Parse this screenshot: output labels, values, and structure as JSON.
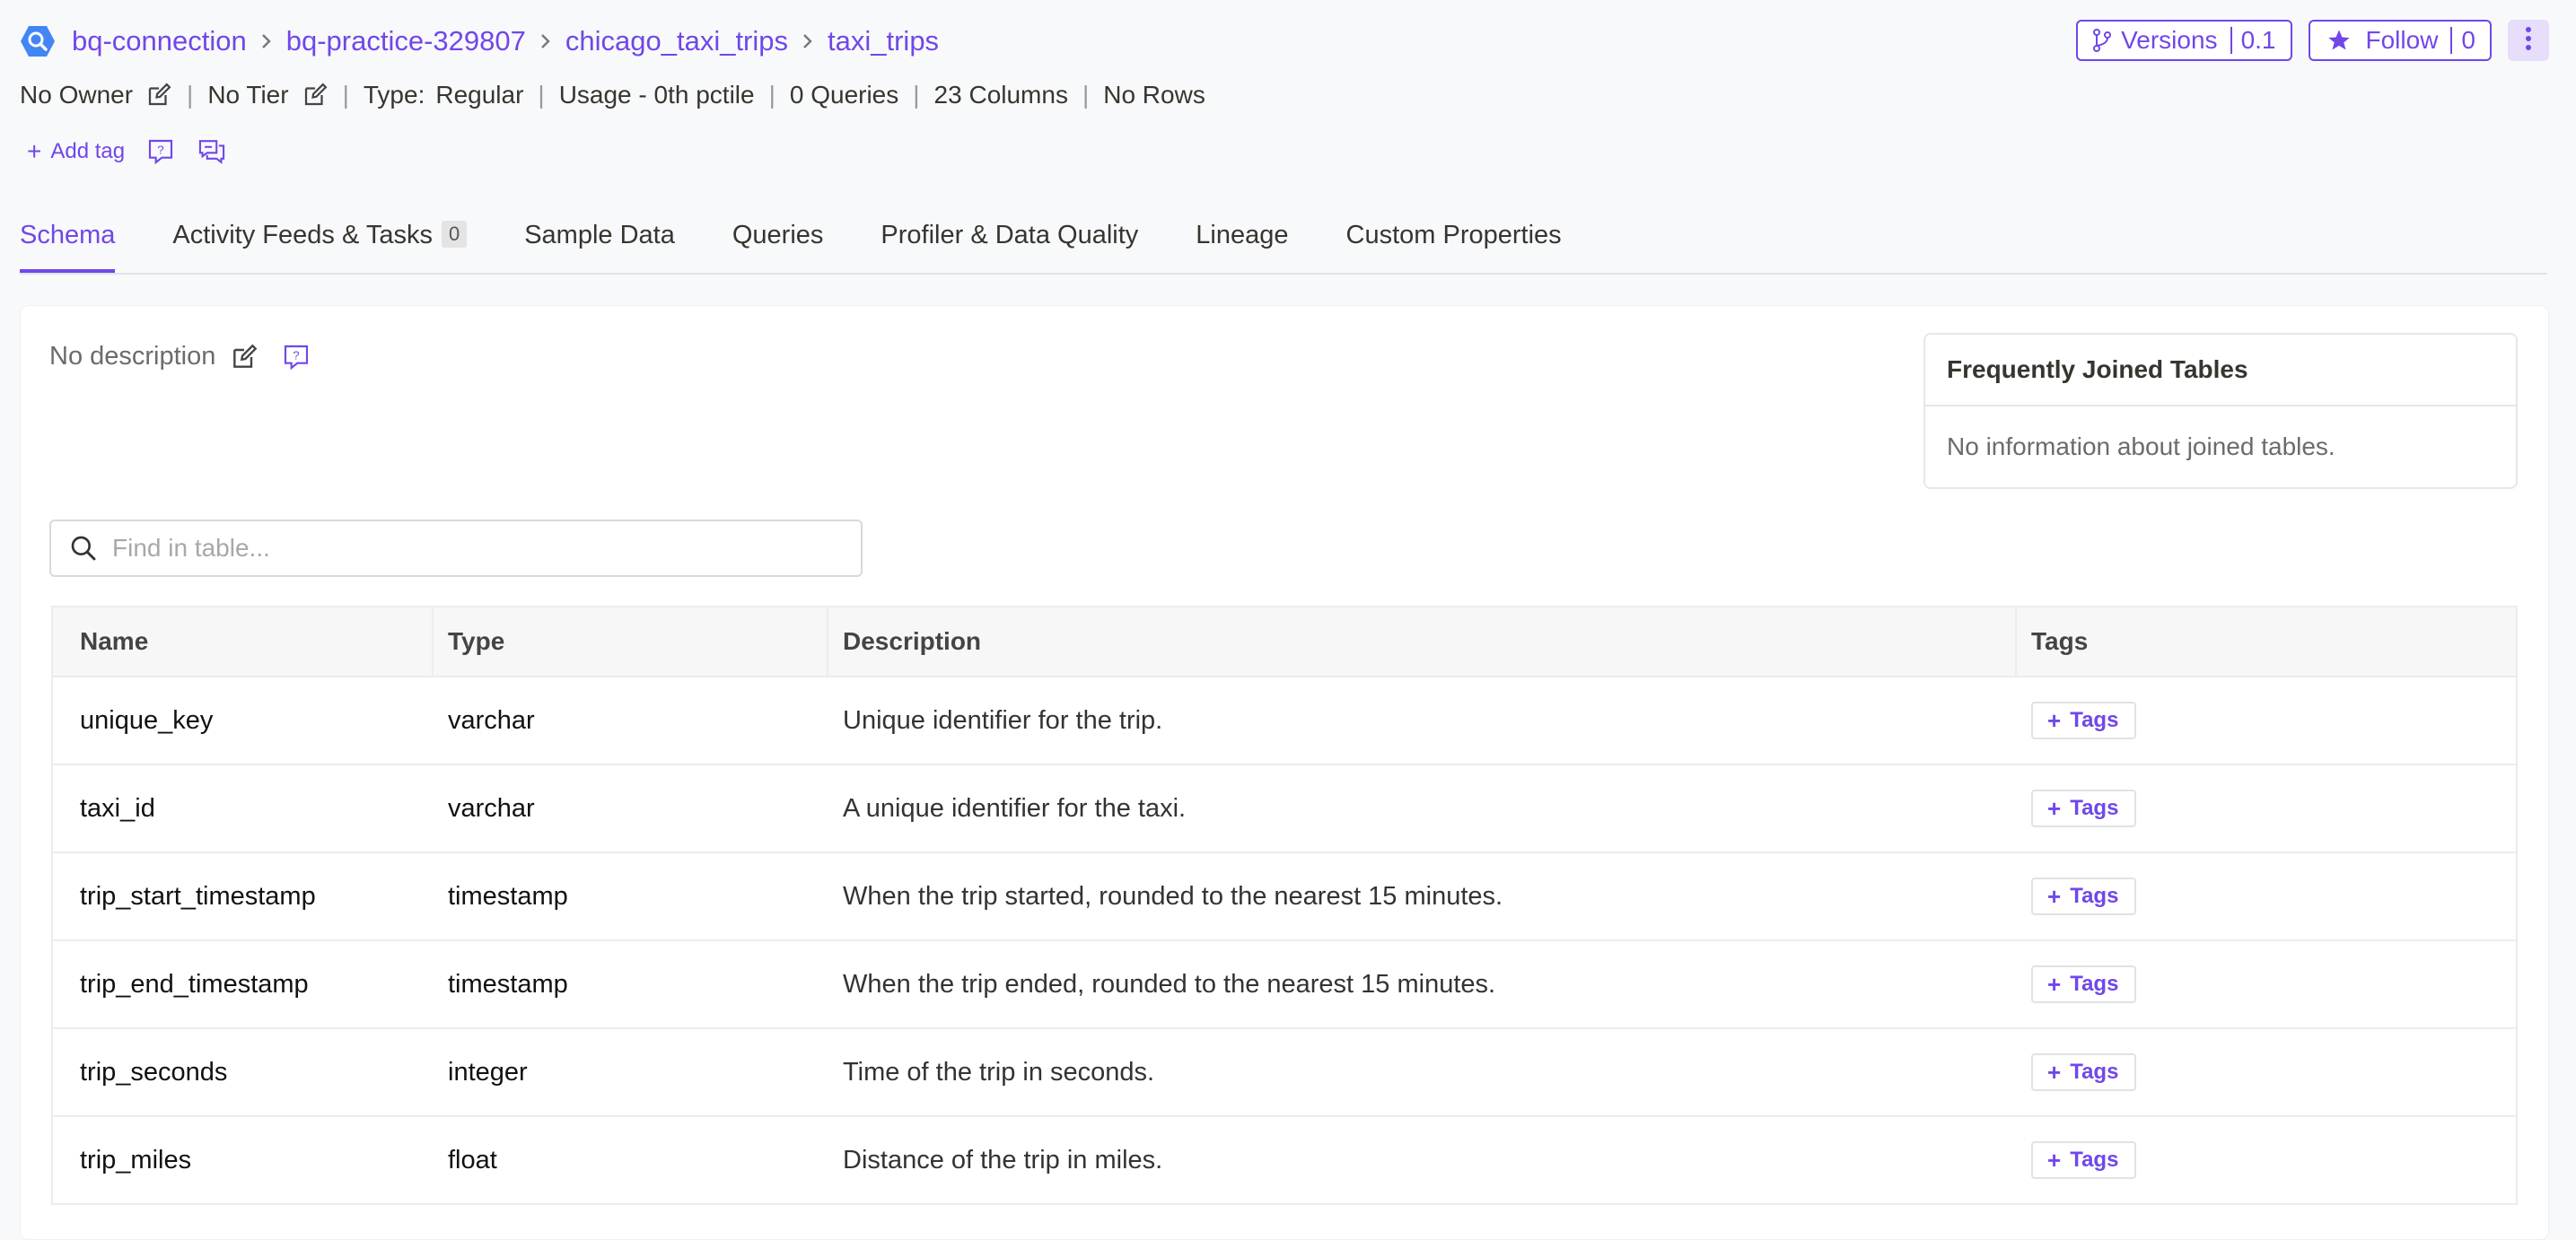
{
  "breadcrumb": {
    "items": [
      "bq-connection",
      "bq-practice-329807",
      "chicago_taxi_trips",
      "taxi_trips"
    ]
  },
  "actions": {
    "versions_label": "Versions",
    "versions_count": "0.1",
    "follow_label": "Follow",
    "follow_count": "0"
  },
  "meta": {
    "owner": "No Owner",
    "tier": "No Tier",
    "type_label": "Type:",
    "type_value": "Regular",
    "usage": "Usage - 0th pctile",
    "queries": "0 Queries",
    "columns": "23 Columns",
    "rows": "No Rows"
  },
  "tag_row": {
    "add_tag": "Add tag"
  },
  "tabs": [
    {
      "label": "Schema",
      "active": true
    },
    {
      "label": "Activity Feeds & Tasks",
      "badge": "0"
    },
    {
      "label": "Sample Data"
    },
    {
      "label": "Queries"
    },
    {
      "label": "Profiler & Data Quality"
    },
    {
      "label": "Lineage"
    },
    {
      "label": "Custom Properties"
    }
  ],
  "description": {
    "text": "No description"
  },
  "joined_tables": {
    "title": "Frequently Joined Tables",
    "empty_text": "No information about joined tables."
  },
  "search": {
    "placeholder": "Find in table..."
  },
  "table": {
    "headers": [
      "Name",
      "Type",
      "Description",
      "Tags"
    ],
    "tag_button_label": "Tags",
    "rows": [
      {
        "name": "unique_key",
        "type": "varchar",
        "description": "Unique identifier for the trip."
      },
      {
        "name": "taxi_id",
        "type": "varchar",
        "description": "A unique identifier for the taxi."
      },
      {
        "name": "trip_start_timestamp",
        "type": "timestamp",
        "description": "When the trip started, rounded to the nearest 15 minutes."
      },
      {
        "name": "trip_end_timestamp",
        "type": "timestamp",
        "description": "When the trip ended, rounded to the nearest 15 minutes."
      },
      {
        "name": "trip_seconds",
        "type": "integer",
        "description": "Time of the trip in seconds."
      },
      {
        "name": "trip_miles",
        "type": "float",
        "description": "Distance of the trip in miles."
      }
    ]
  },
  "colors": {
    "accent": "#7147e8",
    "background": "#f8f9fb",
    "bq_blue": "#4285f4"
  },
  "icons": {
    "service": "bigquery-icon",
    "breadcrumb_sep": "chevron-right-icon",
    "versions": "git-branch-icon",
    "follow": "star-icon",
    "more": "kebab-menu-icon",
    "edit": "edit-icon",
    "request": "request-description-icon",
    "conversation": "conversation-icon",
    "search": "search-icon"
  }
}
